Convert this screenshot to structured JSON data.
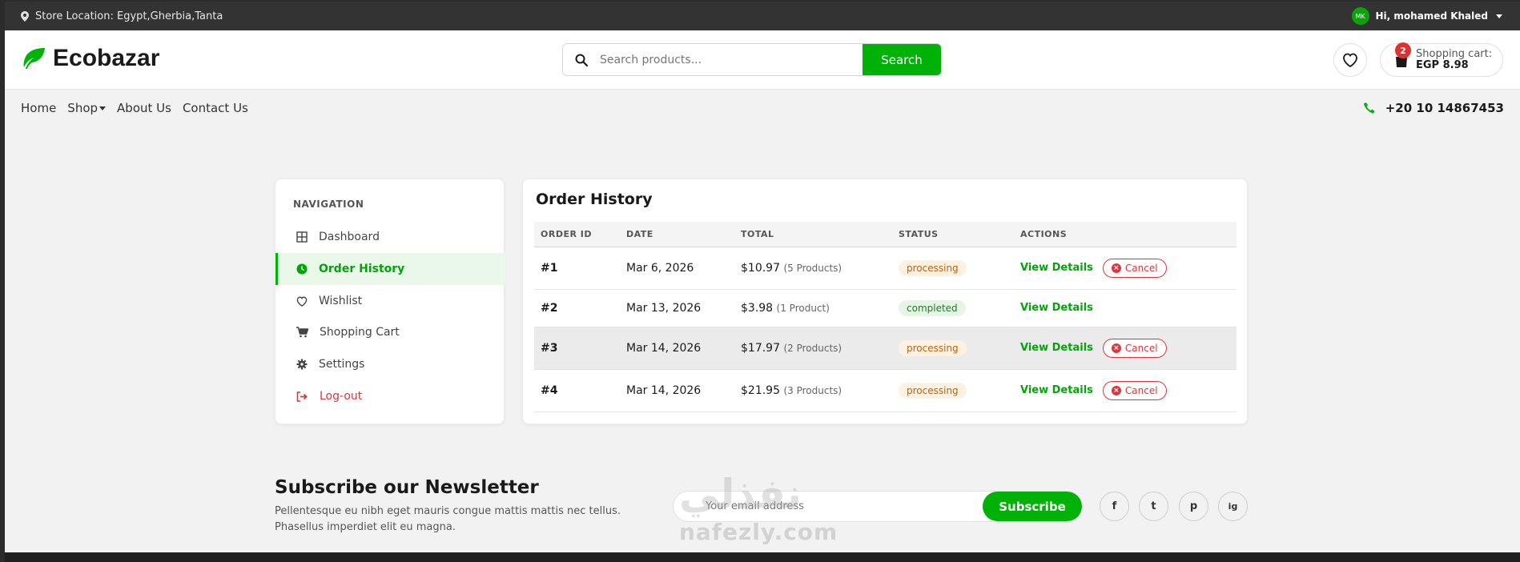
{
  "topbar": {
    "location": "Store Location: Egypt,Gherbia,Tanta",
    "avatar_initials": "MK",
    "greeting": "Hi, mohamed Khaled"
  },
  "header": {
    "logo_text": "Ecobazar",
    "search_placeholder": "Search products...",
    "search_button": "Search",
    "cart_count": "2",
    "cart_label": "Shopping cart:",
    "cart_total": "EGP 8.98"
  },
  "nav": {
    "links": [
      "Home",
      "Shop",
      "About Us",
      "Contact Us"
    ],
    "phone": "+20 10 14867453"
  },
  "sidebar": {
    "title": "NAVIGATION",
    "items": [
      {
        "label": "Dashboard",
        "icon": "dashboard-icon"
      },
      {
        "label": "Order History",
        "icon": "clock-icon",
        "active": true
      },
      {
        "label": "Wishlist",
        "icon": "heart-icon"
      },
      {
        "label": "Shopping Cart",
        "icon": "cart-icon"
      },
      {
        "label": "Settings",
        "icon": "gear-icon"
      },
      {
        "label": "Log-out",
        "icon": "logout-icon"
      }
    ]
  },
  "orders": {
    "title": "Order History",
    "columns": [
      "ORDER ID",
      "DATE",
      "TOTAL",
      "STATUS",
      "ACTIONS"
    ],
    "view_label": "View Details",
    "cancel_label": "Cancel",
    "rows": [
      {
        "id": "#1",
        "date": "Mar 6, 2026",
        "total": "$10.97",
        "count": "(5 Products)",
        "status": "processing"
      },
      {
        "id": "#2",
        "date": "Mar 13, 2026",
        "total": "$3.98",
        "count": "(1 Product)",
        "status": "completed"
      },
      {
        "id": "#3",
        "date": "Mar 14, 2026",
        "total": "$17.97",
        "count": "(2 Products)",
        "status": "processing"
      },
      {
        "id": "#4",
        "date": "Mar 14, 2026",
        "total": "$21.95",
        "count": "(3 Products)",
        "status": "processing"
      }
    ]
  },
  "newsletter": {
    "title": "Subscribe our Newsletter",
    "text": "Pellentesque eu nibh eget mauris congue mattis mattis nec tellus. Phasellus imperdiet elit eu magna.",
    "email_placeholder": "Your email address",
    "button": "Subscribe",
    "social": [
      "f",
      "t",
      "p",
      "ig"
    ]
  },
  "watermark": {
    "arabic": "نفذلي",
    "latin": "nafezly.com"
  },
  "colors": {
    "brand_green": "#00b207",
    "danger_red": "#d9363e",
    "topbar_bg": "#333333"
  }
}
